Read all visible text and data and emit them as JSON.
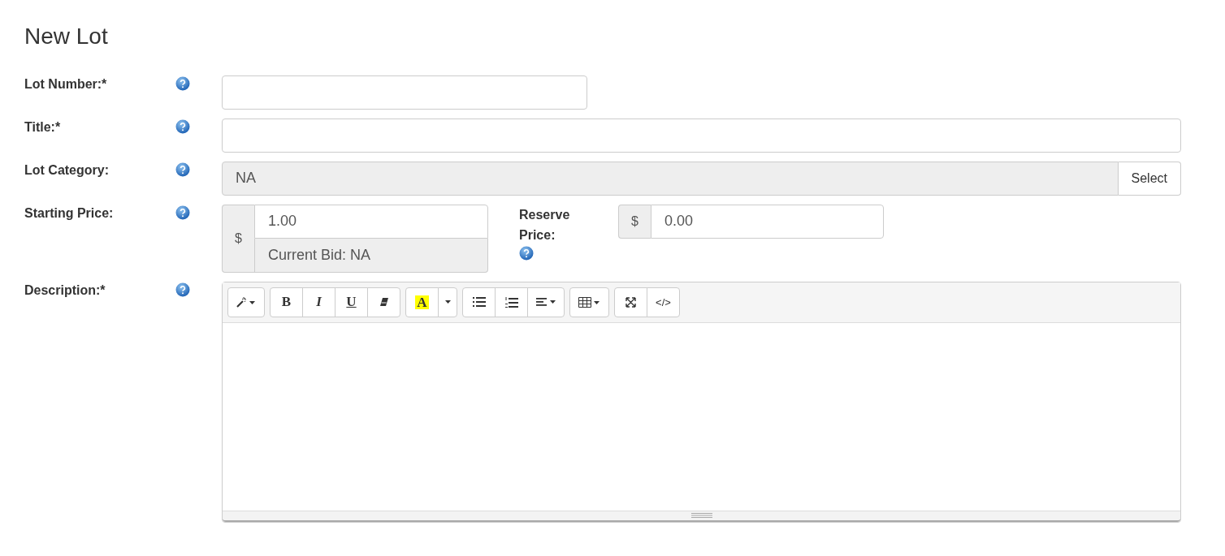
{
  "heading": "New Lot",
  "fields": [
    {
      "kind": "short-text",
      "label": "Lot Number:*"
    },
    {
      "kind": "text",
      "label": "Title:*"
    },
    {
      "kind": "select",
      "label": "Lot Category:",
      "value": "NA",
      "button": "Select"
    },
    {
      "kind": "price",
      "label": "Starting Price:",
      "addon": "$",
      "value": "1.00",
      "note": "Current Bid: NA",
      "reserve": {
        "label": "Reserve Price:",
        "addon": "$",
        "value": "0.00"
      }
    },
    {
      "kind": "editor",
      "label": "Description:*",
      "toolbar": [
        [
          {
            "kind": "magic"
          }
        ],
        [
          {
            "kind": "bold",
            "label": "B"
          },
          {
            "kind": "italic",
            "label": "I"
          },
          {
            "kind": "underline",
            "label": "U"
          },
          {
            "kind": "eraser"
          }
        ],
        [
          {
            "kind": "highlight",
            "label": "A"
          },
          {
            "kind": "caret"
          }
        ],
        [
          {
            "kind": "bullets"
          },
          {
            "kind": "numbers"
          },
          {
            "kind": "align"
          }
        ],
        [
          {
            "kind": "table"
          }
        ],
        [
          {
            "kind": "fullscreen"
          },
          {
            "kind": "code",
            "label": "</>"
          }
        ]
      ]
    }
  ]
}
